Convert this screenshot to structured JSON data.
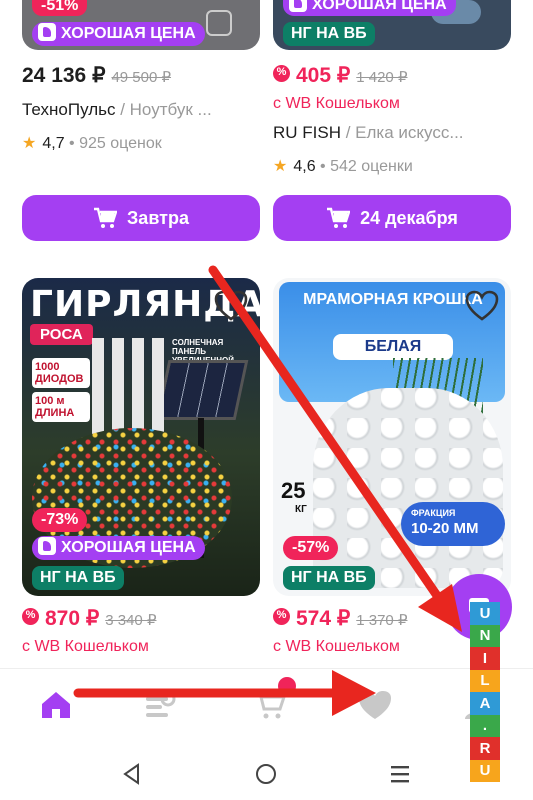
{
  "products": [
    {
      "discount": "-51%",
      "good_price": "ХОРОШАЯ ЦЕНА",
      "price": "24 136 ₽",
      "old_price": "49 500 ₽",
      "brand": "ТехноПульс",
      "name": " / Ноутбук ...",
      "rating": "4,7",
      "reviews": "925 оценок",
      "button": "Завтра"
    },
    {
      "good_price": "ХОРОШАЯ ЦЕНА",
      "ng_badge": "НГ НА ВБ",
      "price": "405 ₽",
      "old_price": "1 420 ₽",
      "wallet": "с WB Кошельком",
      "brand": "RU FISH",
      "name": " / Елка искусс...",
      "rating": "4,6",
      "reviews": "542 оценки",
      "button": "24 декабря"
    },
    {
      "image_title": "ГИРЛЯНДА",
      "image_sub": "РОСА",
      "image_spec1": "1000 ДИОДОВ",
      "image_spec2": "100 м ДЛИНА",
      "image_panel": "СОЛНЕЧНАЯ ПАНЕЛЬ УВЕЛИЧЕННОЙ МОЩНОСТИ",
      "discount": "-73%",
      "good_price": "ХОРОШАЯ ЦЕНА",
      "ng_badge": "НГ НА ВБ",
      "price": "870 ₽",
      "old_price": "3 340 ₽",
      "wallet": "с WB Кошельком"
    },
    {
      "image_title": "МРАМОРНАЯ КРОШКА",
      "image_sub": "БЕЛАЯ",
      "image_weight": "25",
      "image_unit": "КГ",
      "image_fraction_label": "ФРАКЦИЯ",
      "image_fraction": "10-20 ММ",
      "discount": "-57%",
      "ng_badge": "НГ НА ВБ",
      "price": "574 ₽",
      "old_price": "1 370 ₽",
      "wallet": "с WB Кошельком"
    }
  ],
  "nav": {
    "items": [
      "home-icon",
      "catalog-icon",
      "cart-icon",
      "favorites-icon",
      "profile-icon"
    ]
  },
  "system_nav": [
    "back-icon",
    "home-circle-icon",
    "recents-icon"
  ],
  "watermark": {
    "letters": [
      "U",
      "N",
      "I",
      "L",
      "A",
      ".",
      "R",
      "U"
    ],
    "colors": [
      "#2f9ad6",
      "#3aa84a",
      "#e0302b",
      "#f7a51c",
      "#2f9ad6",
      "#3aa84a",
      "#e0302b",
      "#f7a51c"
    ]
  },
  "colors": {
    "accent": "#a43ff2",
    "discount": "#f0245a",
    "green": "#0d7f66",
    "arrow": "#e8261f"
  }
}
